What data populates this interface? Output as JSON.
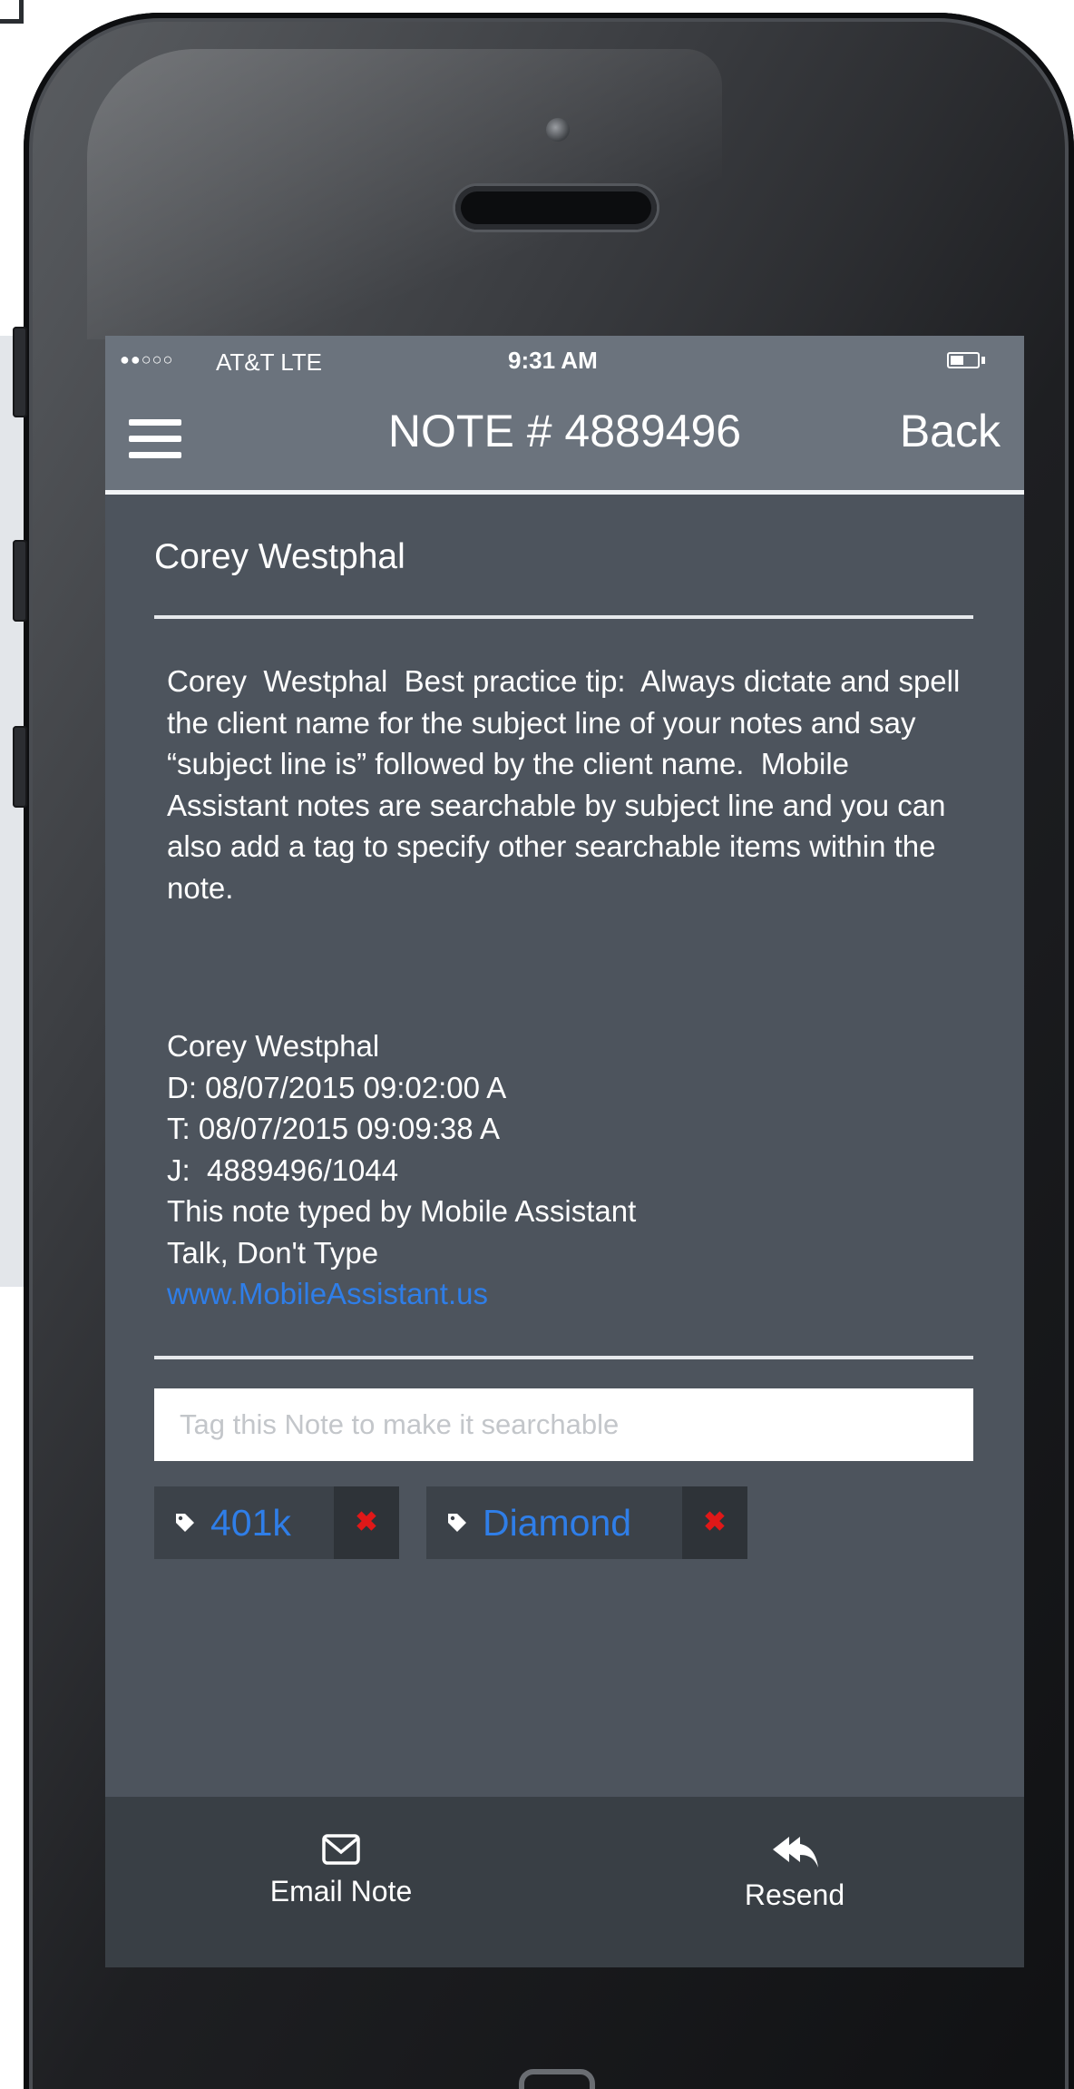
{
  "status_bar": {
    "signal": "●●○○○",
    "carrier": "AT&T  LTE",
    "time": "9:31 AM"
  },
  "header": {
    "title": "NOTE # 4889496",
    "back_label": "Back"
  },
  "note": {
    "subject": "Corey Westphal",
    "body": "Corey  Westphal  Best practice tip:  Always dictate and spell the client name for the subject line of your notes and say “subject line is” followed by the client name.  Mobile Assistant notes are searchable by subject line and you can also add a tag to specify other searchable items within the note.",
    "signature": {
      "name": "Corey Westphal",
      "dictated": "D: 08/07/2015 09:02:00 A",
      "typed": "T: 08/07/2015 09:09:38 A",
      "job": "J:  4889496/1044",
      "typed_by": "This note typed by Mobile Assistant",
      "slogan": "Talk, Don't Type",
      "website": "www.MobileAssistant.us"
    }
  },
  "tags": {
    "input_placeholder": "Tag this Note to make it searchable",
    "items": [
      {
        "label": "401k",
        "remove": "✖"
      },
      {
        "label": "Diamond",
        "remove": "✖"
      }
    ]
  },
  "footer": {
    "email_label": "Email Note",
    "resend_label": "Resend"
  },
  "colors": {
    "header": "#6b737d",
    "content": "#4d545d",
    "footer": "#393f45",
    "link": "#2f7ee8",
    "remove": "#e01818"
  }
}
